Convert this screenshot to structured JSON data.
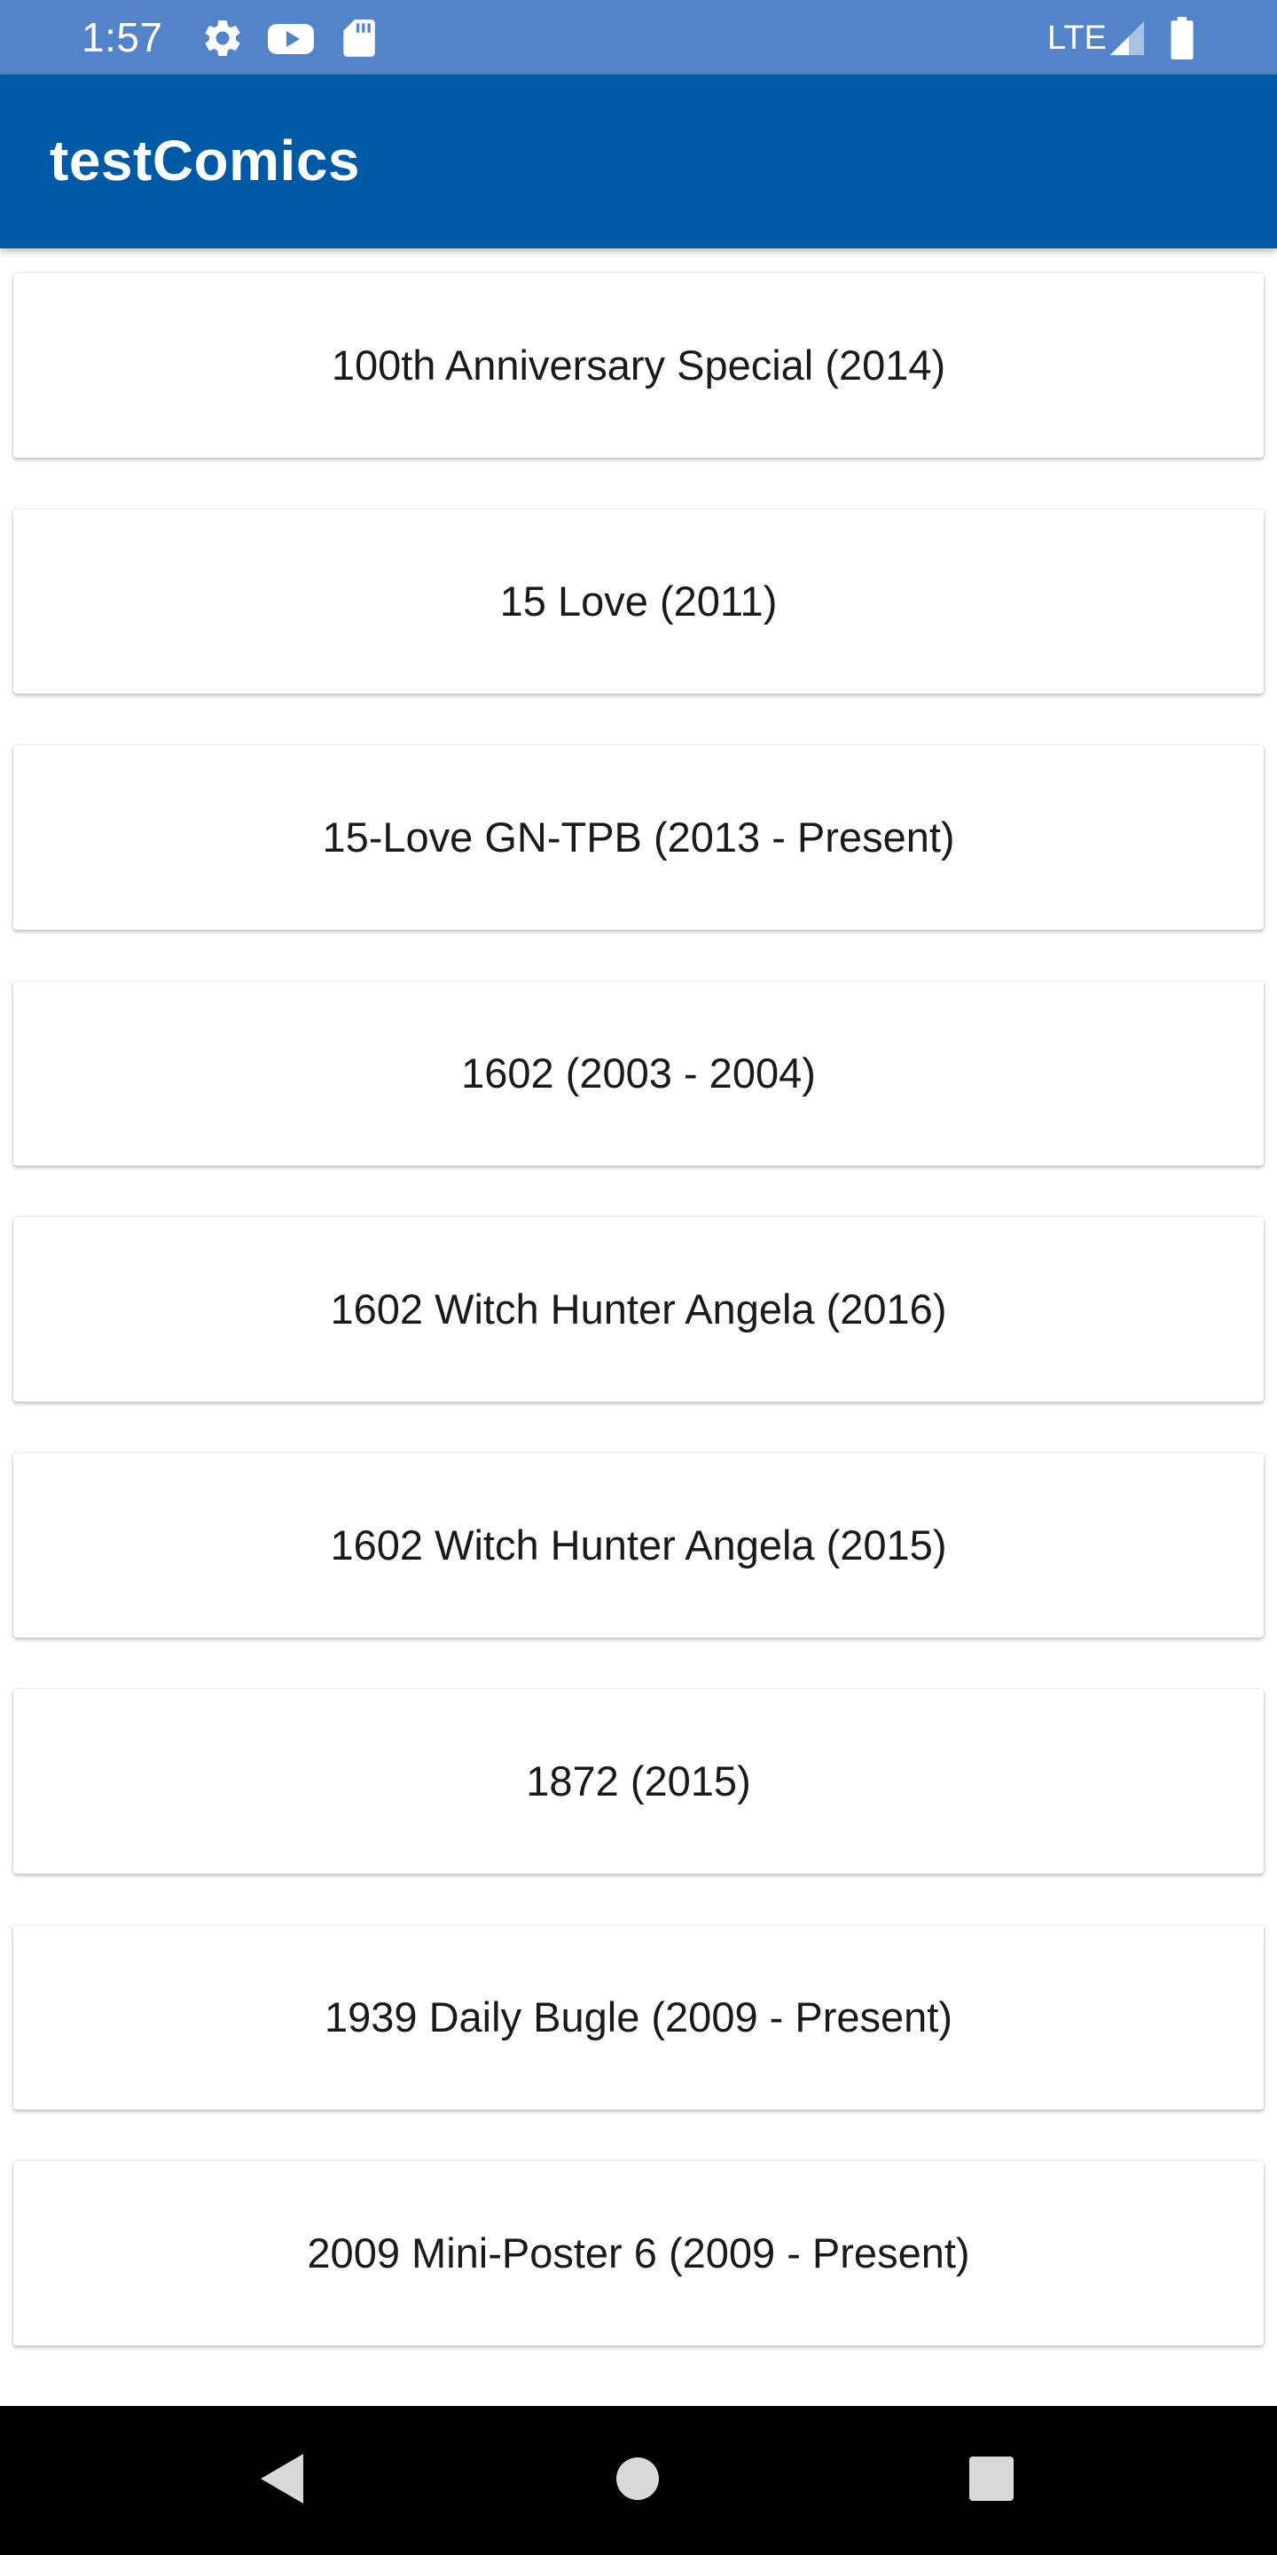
{
  "status_bar": {
    "time": "1:57",
    "network": "LTE",
    "background_color": "#5383c8",
    "icons": [
      "settings-icon",
      "youtube-icon",
      "sd-card-icon",
      "signal-icon",
      "battery-icon"
    ]
  },
  "app_bar": {
    "title": "testComics",
    "background_color": "#0059a4"
  },
  "comics": [
    {
      "title": "100th Anniversary Special (2014)"
    },
    {
      "title": "15 Love (2011)"
    },
    {
      "title": "15-Love GN-TPB (2013 - Present)"
    },
    {
      "title": "1602 (2003 - 2004)"
    },
    {
      "title": "1602 Witch Hunter Angela (2016)"
    },
    {
      "title": "1602 Witch Hunter Angela (2015)"
    },
    {
      "title": "1872 (2015)"
    },
    {
      "title": "1939 Daily Bugle (2009 - Present)"
    },
    {
      "title": "2009 Mini-Poster 6 (2009 - Present)"
    }
  ],
  "nav_bar": {
    "buttons": [
      "back-icon",
      "home-icon",
      "recents-icon"
    ]
  }
}
